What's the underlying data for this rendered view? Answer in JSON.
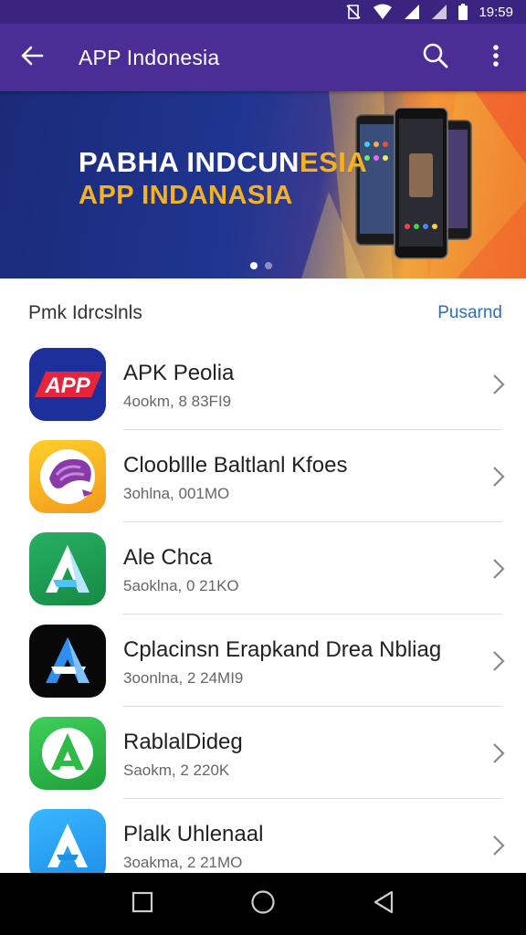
{
  "status_bar": {
    "time": "19:59",
    "icons": [
      "mute-icon",
      "wifi-icon",
      "signal-icon",
      "signal-icon",
      "battery-icon"
    ]
  },
  "app_bar": {
    "title": "APP Indonesia",
    "back_icon": "back-arrow-icon",
    "search_icon": "search-icon",
    "menu_icon": "more-vert-icon"
  },
  "banner": {
    "line1_part1": "PABHA INDCUN",
    "line1_part2": "ESIA",
    "line2": "APP INDANASIA",
    "dots": 2,
    "active_dot": 0
  },
  "section": {
    "title": "Pmk Idrcslnls",
    "link": "Pusarnd"
  },
  "apps": [
    {
      "name": "APK Peolia",
      "meta": "4ookm, 8 83FI9",
      "icon": "app-logo-icon",
      "bg": "#1f3aa8"
    },
    {
      "name": "Cloobllle Baltlanl Kfoes",
      "meta": "3ohlna, 001MO",
      "icon": "swirl-logo-icon",
      "bg": "#f6b61f"
    },
    {
      "name": "Ale Chca",
      "meta": "5aoklna, 0 21KO",
      "icon": "a-logo-icon",
      "bg": "#1f9a55"
    },
    {
      "name": "Cplacinsn Erapkand Drea Nbliag",
      "meta": "3oonlna, 2 24MI9",
      "icon": "a-logo-icon",
      "bg": "#0a0a0a"
    },
    {
      "name": "RablalDideg",
      "meta": "Saokm, 2 220K",
      "icon": "a-logo-icon",
      "bg": "#2fba48"
    },
    {
      "name": "Plalk Uhlenaal",
      "meta": "3oakma, 2 21MO",
      "icon": "a-logo-icon",
      "bg": "#2aa2f0"
    }
  ],
  "nav": {
    "recents_icon": "square-icon",
    "home_icon": "circle-icon",
    "back_icon": "triangle-back-icon"
  }
}
